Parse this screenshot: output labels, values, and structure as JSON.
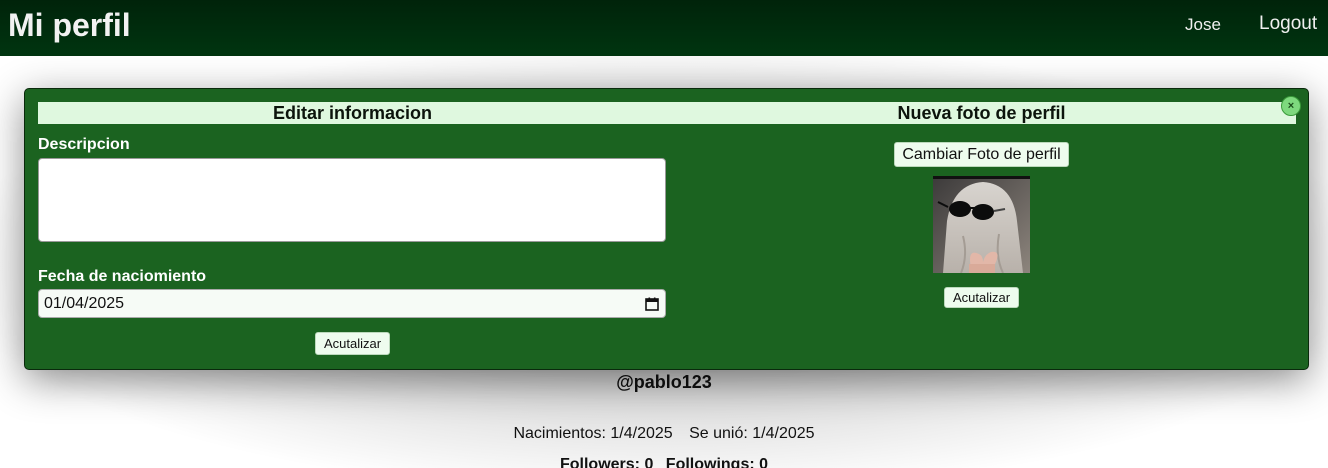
{
  "navbar": {
    "title": "Mi perfil",
    "user": "Jose",
    "logout": "Logout"
  },
  "modal": {
    "left_header": "Editar informacion",
    "right_header": "Nueva foto de perfil",
    "close_symbol": "×",
    "description_label": "Descripcion",
    "description_value": "",
    "birthdate_label": "Fecha de naciomiento",
    "birthdate_value": "01/04/2025",
    "update_info_button": "Acutalizar",
    "change_photo_button": "Cambiar Foto de perfil",
    "update_photo_button": "Acutalizar"
  },
  "profile": {
    "username": "@pablo123",
    "birth_text": "Nacimientos: 1/4/2025",
    "joined_text": "Se unió: 1/4/2025",
    "followers_text": "Followers: 0",
    "followings_text": "Followings: 0"
  },
  "icons": {
    "close": "close-icon",
    "calendar": "calendar-icon",
    "photo": "profile-photo"
  },
  "colors": {
    "navbar": "#00230a",
    "modal_background": "#1b6320",
    "header_bar": "#dff8df",
    "close_button": "#7ed97e"
  }
}
